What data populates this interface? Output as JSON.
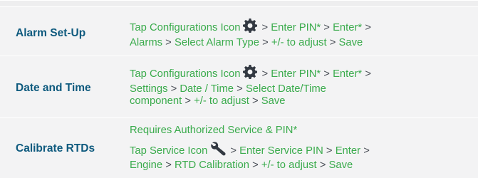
{
  "rows": [
    {
      "label": "Alarm Set-Up",
      "line1_a": "Tap Configurations Icon",
      "icon": "gear-icon",
      "line1_b": "Enter PIN*",
      "line1_c": "Enter*",
      "line2_a": "Alarms",
      "line2_b": "Select Alarm Type",
      "line2_c": "+/- to adjust",
      "line2_d": "Save"
    },
    {
      "label": "Date and Time",
      "line1_a": "Tap Configurations Icon",
      "icon": "gear-icon",
      "line1_b": "Enter PIN*",
      "line1_c": "Enter*",
      "line2_a": "Settings",
      "line2_b": "Date / Time",
      "line2_c": "Select Date/Time",
      "line3_a": "component",
      "line3_b": "+/- to adjust",
      "line3_c": "Save"
    },
    {
      "label": "Calibrate RTDs",
      "note": "Requires Authorized Service & PIN*",
      "line1_a": "Tap Service Icon",
      "icon": "wrench-icon",
      "line1_b": "Enter Service PIN",
      "line1_c": "Enter",
      "line2_a": "Engine",
      "line2_b": "RTD Calibration",
      "line2_c": "+/- to adjust",
      "line2_d": "Save"
    }
  ],
  "separator": ">",
  "colors": {
    "label": "#0e5a7e",
    "instruction": "#3aab4c",
    "separator": "#4a4f57",
    "row_background": "#f3f3f4"
  }
}
